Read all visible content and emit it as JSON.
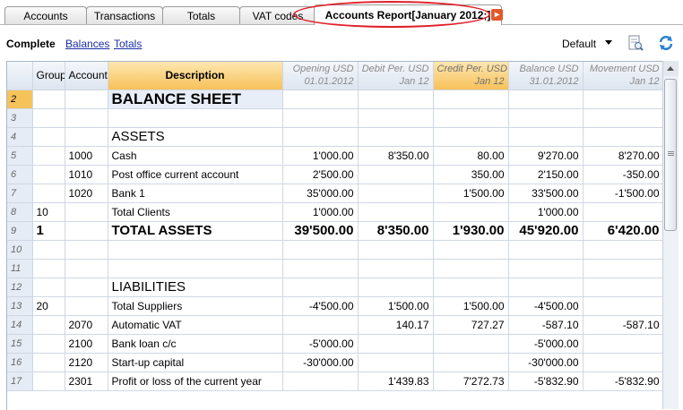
{
  "tabs": [
    {
      "label": "Accounts"
    },
    {
      "label": "Transactions"
    },
    {
      "label": "Totals"
    },
    {
      "label": "VAT codes"
    },
    {
      "label": "Accounts Report[January 2012;]"
    }
  ],
  "toolbar": {
    "complete": "Complete",
    "balances": "Balances",
    "totals": "Totals",
    "view_select": "Default",
    "icons": [
      "print-preview-icon",
      "refresh-icon"
    ]
  },
  "headers": {
    "group": "Group",
    "account": "Account",
    "description": "Description",
    "opening": [
      "Opening USD",
      "01.01.2012"
    ],
    "debit": [
      "Debit Per. USD",
      "Jan  12"
    ],
    "credit": [
      "Credit Per. USD",
      "Jan  12"
    ],
    "balance": [
      "Balance USD",
      "31.01.2012"
    ],
    "movement": [
      "Movement USD",
      "Jan  12"
    ]
  },
  "rows": [
    {
      "n": "2",
      "group": "",
      "account": "",
      "desc": "BALANCE SHEET",
      "opening": "",
      "debit": "",
      "credit": "",
      "balance": "",
      "movement": ""
    },
    {
      "n": "3",
      "group": "",
      "account": "",
      "desc": "",
      "opening": "",
      "debit": "",
      "credit": "",
      "balance": "",
      "movement": ""
    },
    {
      "n": "4",
      "group": "",
      "account": "",
      "desc": "ASSETS",
      "opening": "",
      "debit": "",
      "credit": "",
      "balance": "",
      "movement": ""
    },
    {
      "n": "5",
      "group": "",
      "account": "1000",
      "desc": "Cash",
      "opening": "1'000.00",
      "debit": "8'350.00",
      "credit": "80.00",
      "balance": "9'270.00",
      "movement": "8'270.00"
    },
    {
      "n": "6",
      "group": "",
      "account": "1010",
      "desc": "Post office current account",
      "opening": "2'500.00",
      "debit": "",
      "credit": "350.00",
      "balance": "2'150.00",
      "movement": "-350.00"
    },
    {
      "n": "7",
      "group": "",
      "account": "1020",
      "desc": "Bank 1",
      "opening": "35'000.00",
      "debit": "",
      "credit": "1'500.00",
      "balance": "33'500.00",
      "movement": "-1'500.00"
    },
    {
      "n": "8",
      "group": "10",
      "account": "",
      "desc": "Total Clients",
      "opening": "1'000.00",
      "debit": "",
      "credit": "",
      "balance": "1'000.00",
      "movement": ""
    },
    {
      "n": "9",
      "group": "1",
      "account": "",
      "desc": "TOTAL ASSETS",
      "opening": "39'500.00",
      "debit": "8'350.00",
      "credit": "1'930.00",
      "balance": "45'920.00",
      "movement": "6'420.00"
    },
    {
      "n": "10",
      "group": "",
      "account": "",
      "desc": "",
      "opening": "",
      "debit": "",
      "credit": "",
      "balance": "",
      "movement": ""
    },
    {
      "n": "11",
      "group": "",
      "account": "",
      "desc": "",
      "opening": "",
      "debit": "",
      "credit": "",
      "balance": "",
      "movement": ""
    },
    {
      "n": "12",
      "group": "",
      "account": "",
      "desc": "LIABILITIES",
      "opening": "",
      "debit": "",
      "credit": "",
      "balance": "",
      "movement": ""
    },
    {
      "n": "13",
      "group": "20",
      "account": "",
      "desc": "Total Suppliers",
      "opening": "-4'500.00",
      "debit": "1'500.00",
      "credit": "1'500.00",
      "balance": "-4'500.00",
      "movement": ""
    },
    {
      "n": "14",
      "group": "",
      "account": "2070",
      "desc": "Automatic VAT",
      "opening": "",
      "debit": "140.17",
      "credit": "727.27",
      "balance": "-587.10",
      "movement": "-587.10"
    },
    {
      "n": "15",
      "group": "",
      "account": "2100",
      "desc": "Bank loan c/c",
      "opening": "-5'000.00",
      "debit": "",
      "credit": "",
      "balance": "-5'000.00",
      "movement": ""
    },
    {
      "n": "16",
      "group": "",
      "account": "2120",
      "desc": "Start-up capital",
      "opening": "-30'000.00",
      "debit": "",
      "credit": "",
      "balance": "-30'000.00",
      "movement": ""
    },
    {
      "n": "17",
      "group": "",
      "account": "2301",
      "desc": "Profit or loss of the current year",
      "opening": "",
      "debit": "1'439.83",
      "credit": "7'272.73",
      "balance": "-5'832.90",
      "movement": "-5'832.90"
    }
  ]
}
